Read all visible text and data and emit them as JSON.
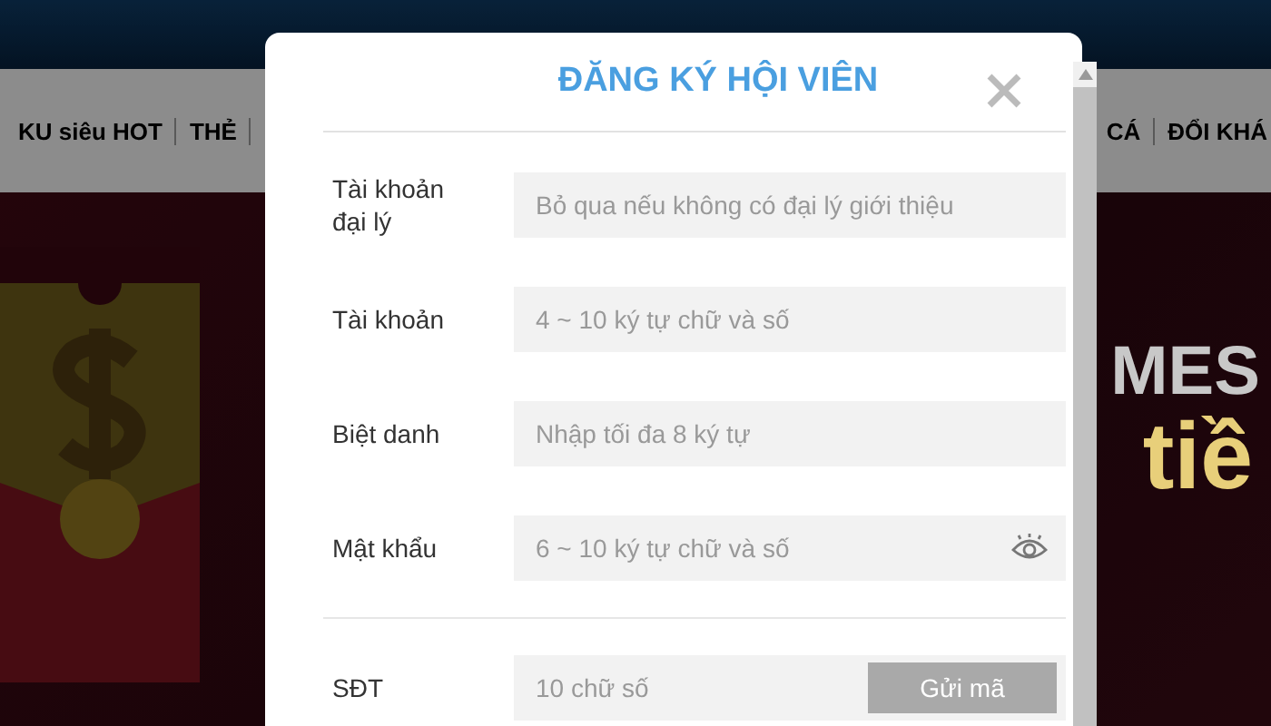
{
  "page": {
    "nav": [
      {
        "label": "KU siêu HOT"
      },
      {
        "label": "THẺ"
      },
      {
        "label": "CÁ"
      },
      {
        "label": "ĐỔI KHÁ"
      }
    ],
    "banner": {
      "headline": "MES",
      "subline": "tiề"
    }
  },
  "dialog": {
    "title": "ĐĂNG KÝ HỘI VIÊN",
    "fields": [
      {
        "kind": "text",
        "label": "Tài khoản đại lý",
        "placeholder": "Bỏ qua nếu không có đại lý giới thiệu"
      },
      {
        "kind": "text",
        "label": "Tài khoản",
        "placeholder": "4 ~ 10 ký tự chữ và số"
      },
      {
        "kind": "text",
        "label": "Biệt danh",
        "placeholder": "Nhập tối đa 8 ký tự"
      },
      {
        "kind": "password",
        "label": "Mật khẩu",
        "placeholder": "6 ~ 10 ký tự chữ và số"
      },
      {
        "kind": "code",
        "label": "SĐT",
        "placeholder": "10 chữ số",
        "button": "Gửi mã"
      }
    ]
  }
}
